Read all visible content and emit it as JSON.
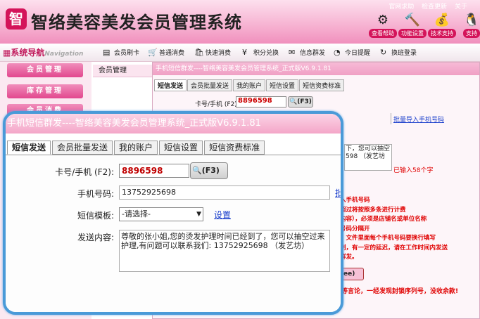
{
  "header": {
    "logo_glyph": "智",
    "title": "智络美容美发会员管理系统",
    "top_links": [
      "官网求助",
      "检查更新",
      "关于"
    ],
    "icons": [
      {
        "name": "help-icon",
        "glyph": "⚙",
        "label": "查看帮助"
      },
      {
        "name": "tools-icon",
        "glyph": "🔨",
        "label": "功能设置"
      },
      {
        "name": "money-icon",
        "glyph": "💰",
        "label": "技术支持"
      },
      {
        "name": "qq-icon",
        "glyph": "🐧",
        "label": "支持"
      }
    ]
  },
  "nav": {
    "title": "系统导航",
    "subtitle": "Navigation"
  },
  "toolbar": [
    {
      "icon": "card-icon",
      "glyph": "▤",
      "label": "会员刷卡"
    },
    {
      "icon": "cart-icon",
      "glyph": "🛒",
      "label": "普通消费"
    },
    {
      "icon": "fast-icon",
      "glyph": "🛍",
      "label": "快速消费"
    },
    {
      "icon": "points-icon",
      "glyph": "¥",
      "label": "积分兑换"
    },
    {
      "icon": "message-icon",
      "glyph": "✉",
      "label": "信息群发"
    },
    {
      "icon": "clock-icon",
      "glyph": "◔",
      "label": "今日提醒"
    },
    {
      "icon": "switch-icon",
      "glyph": "↻",
      "label": "换班登录"
    }
  ],
  "sidebar": [
    "会员管理",
    "库存管理",
    "会员消费"
  ],
  "main_header": "会员管理",
  "bg_window": {
    "title": "手机短信群发----智络美容美发会员管理系统_正式版V6.9.1.81",
    "tabs": [
      "短信发送",
      "会员批量发送",
      "我的账户",
      "短信设置",
      "短信资费标准"
    ],
    "card_label": "卡号/手机 (F2):",
    "card_value": "8896598",
    "f3": "(F3)",
    "batch_import": "批量导入手机号码",
    "text_tail_1": "下，您可以抽空",
    "text_tail_2": "598 （发艺坊",
    "chars_typed": "已输入58个字",
    "hints": [
      "入手机号码",
      "超过将按照多条进行计费",
      "内容），必须是店铺名或单位名称",
      "号码分隔开",
      "，文件里面每个手机号码要换行填写",
      "制，有一定的延迟，请在工作时间内发送",
      "群发。"
    ],
    "send_fragment": "ee)",
    "warning": "等言论，一经发现封锁序列号，没收余款!"
  },
  "zoom": {
    "title": "手机短信群发----智络美容美发会员管理系统_正式版V6.9.1.81",
    "tabs": [
      "短信发送",
      "会员批量发送",
      "我的账户",
      "短信设置",
      "短信资费标准"
    ],
    "card_label": "卡号/手机 (F2):",
    "card_value": "8896598",
    "f3_label": "(F3)",
    "phone_label": "手机号码:",
    "phone_value": "13752925698",
    "edge_link": "批",
    "template_label": "短信模板:",
    "template_value": "-请选择-",
    "settings_link": "设置",
    "content_label": "发送内容:",
    "content_value": "尊敬的张小姐,您的烫发护理时间已经到了，您可以抽空过来护理,有问题可以联系我们: 13752925698 （发艺坊）"
  }
}
